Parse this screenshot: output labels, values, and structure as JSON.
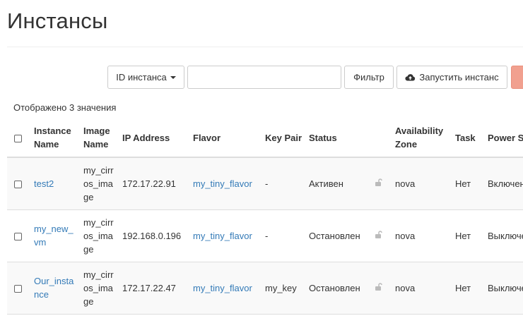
{
  "page": {
    "title": "Инстансы"
  },
  "toolbar": {
    "filter_field_label": "ID инстанса",
    "search_value": "",
    "search_placeholder": "",
    "filter_button": "Фильтр",
    "launch_button": "Запустить инстанс"
  },
  "summary": {
    "count_text": "Отображено 3 значения"
  },
  "table": {
    "headers": {
      "instance_name": "Instance Name",
      "image_name": "Image Name",
      "ip_address": "IP Address",
      "flavor": "Flavor",
      "key_pair": "Key Pair",
      "status": "Status",
      "availability_zone": "Availability Zone",
      "task": "Task",
      "power_state": "Power State"
    },
    "rows": [
      {
        "instance_name": "test2",
        "image_name": "my_cirros_image",
        "ip_address": "172.17.22.91",
        "flavor": "my_tiny_flavor",
        "key_pair": "-",
        "status": "Активен",
        "availability_zone": "nova",
        "task": "Нет",
        "power_state": "Включен"
      },
      {
        "instance_name": "my_new_vm",
        "image_name": "my_cirros_image",
        "ip_address": "192.168.0.196",
        "flavor": "my_tiny_flavor",
        "key_pair": "-",
        "status": "Остановлен",
        "availability_zone": "nova",
        "task": "Нет",
        "power_state": "Выключен"
      },
      {
        "instance_name": "Our_instance",
        "image_name": "my_cirros_image",
        "ip_address": "172.17.22.47",
        "flavor": "my_tiny_flavor",
        "key_pair": "my_key",
        "status": "Остановлен",
        "availability_zone": "nova",
        "task": "Нет",
        "power_state": "Выключен"
      }
    ]
  },
  "colors": {
    "link": "#337ab7",
    "danger_button": "#f1a08f",
    "row_alt": "#f9f9f9"
  },
  "icons": {
    "launch": "cloud-upload-icon",
    "status_lock": "unlock-icon",
    "dropdown": "caret-down-icon"
  }
}
